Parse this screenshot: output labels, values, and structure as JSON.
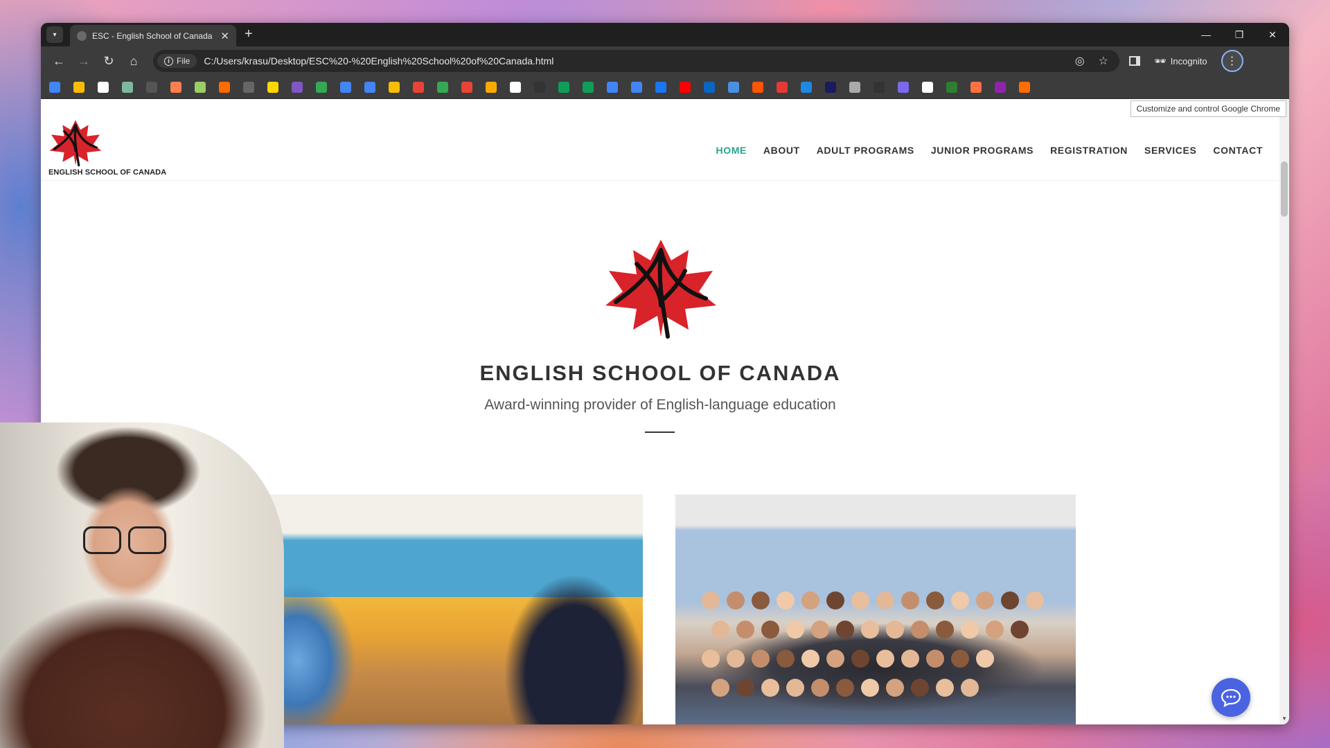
{
  "browser": {
    "tab_title": "ESC - English School of Canada",
    "tab_close": "✕",
    "new_tab": "+",
    "url": "C:/Users/krasu/Desktop/ESC%20-%20English%20School%20of%20Canada.html",
    "file_chip": "File",
    "incognito_label": "Incognito",
    "tooltip": "Customize and control Google Chrome",
    "bookmark_colors": [
      "#4285f4",
      "#fbbc04",
      "#ffffff",
      "#7fb8a0",
      "#555555",
      "#ff7f50",
      "#9ccc65",
      "#ff6b00",
      "#666666",
      "#ffd600",
      "#7e57c2",
      "#34a853",
      "#4285f4",
      "#4285f4",
      "#fbbc04",
      "#ea4335",
      "#34a853",
      "#ea4335",
      "#f9ab00",
      "#ffffff",
      "#333333",
      "#0f9d58",
      "#0f9d58",
      "#4285f4",
      "#4285f4",
      "#1877f2",
      "#ff0000",
      "#0a66c2",
      "#4a90e2",
      "#ff5500",
      "#e53935",
      "#1e88e5",
      "#1a1a5e",
      "#aaaaaa",
      "#333333",
      "#7b68ee",
      "#ffffff",
      "#2e7d32",
      "#ff7043",
      "#8e24aa",
      "#ff6d00"
    ]
  },
  "header": {
    "logo_text": "ENGLISH SCHOOL OF CANADA",
    "nav": [
      {
        "label": "HOME",
        "active": true
      },
      {
        "label": "ABOUT"
      },
      {
        "label": "ADULT PROGRAMS"
      },
      {
        "label": "JUNIOR PROGRAMS"
      },
      {
        "label": "REGISTRATION"
      },
      {
        "label": "SERVICES"
      },
      {
        "label": "CONTACT"
      }
    ]
  },
  "hero": {
    "title": "ENGLISH SCHOOL OF CANADA",
    "subtitle": "Award-winning provider of English-language education"
  },
  "colors": {
    "accent": "#2aa38c",
    "maple_red": "#d8232a",
    "chat_button": "#4a63e0"
  },
  "icons": {
    "chat": "chat-bubble-icon"
  }
}
